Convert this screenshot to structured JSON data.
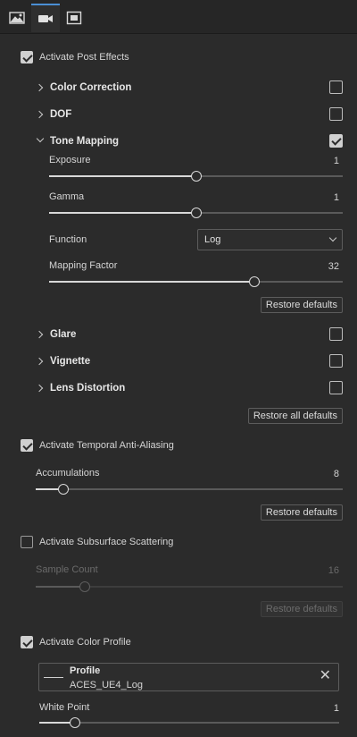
{
  "tabs": [
    {
      "icon": "scene-image-icon",
      "active": false
    },
    {
      "icon": "camera-icon",
      "active": true
    },
    {
      "icon": "frame-icon",
      "active": false
    }
  ],
  "post_effects": {
    "label": "Activate Post Effects",
    "checked": true
  },
  "color_correction": {
    "label": "Color Correction",
    "enabled": false
  },
  "dof": {
    "label": "DOF",
    "enabled": false
  },
  "tone_mapping": {
    "label": "Tone Mapping",
    "enabled": true,
    "exposure": {
      "label": "Exposure",
      "value": "1",
      "level": 0.5
    },
    "gamma": {
      "label": "Gamma",
      "value": "1",
      "level": 0.5
    },
    "function": {
      "label": "Function",
      "selected": "Log"
    },
    "mapping_factor": {
      "label": "Mapping Factor",
      "value": "32",
      "level": 0.7
    },
    "restore": "Restore defaults"
  },
  "glare": {
    "label": "Glare",
    "enabled": false
  },
  "vignette": {
    "label": "Vignette",
    "enabled": false
  },
  "lens_distortion": {
    "label": "Lens Distortion",
    "enabled": false
  },
  "restore_all": "Restore all defaults",
  "taa": {
    "label": "Activate Temporal Anti-Aliasing",
    "checked": true,
    "accumulations": {
      "label": "Accumulations",
      "value": "8",
      "level": 0.09
    },
    "restore": "Restore defaults"
  },
  "sss": {
    "label": "Activate Subsurface Scattering",
    "checked": false,
    "sample_count": {
      "label": "Sample Count",
      "value": "16",
      "level": 0.16
    },
    "restore": "Restore defaults"
  },
  "color_profile": {
    "label": "Activate Color Profile",
    "checked": true,
    "profile_title": "Profile",
    "profile_value": "ACES_UE4_Log",
    "white_point": {
      "label": "White Point",
      "value": "1",
      "level": 0.12
    }
  }
}
